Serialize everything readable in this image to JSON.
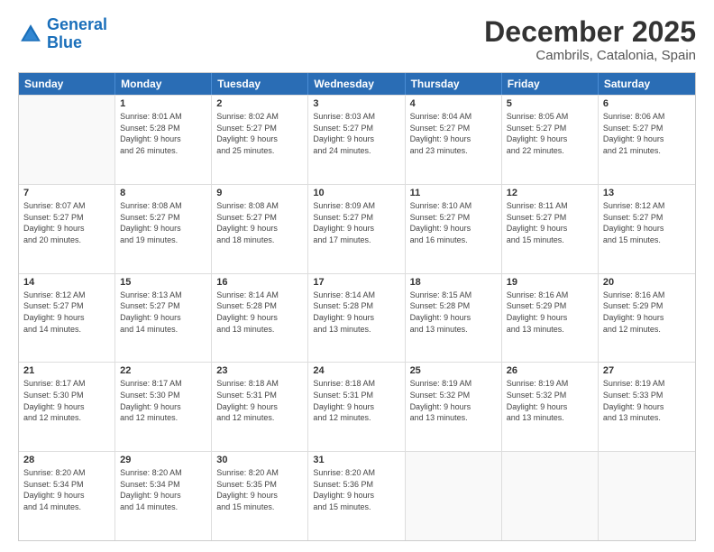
{
  "logo": {
    "line1": "General",
    "line2": "Blue"
  },
  "title": "December 2025",
  "subtitle": "Cambrils, Catalonia, Spain",
  "header_days": [
    "Sunday",
    "Monday",
    "Tuesday",
    "Wednesday",
    "Thursday",
    "Friday",
    "Saturday"
  ],
  "weeks": [
    [
      {
        "day": "",
        "info": ""
      },
      {
        "day": "1",
        "info": "Sunrise: 8:01 AM\nSunset: 5:28 PM\nDaylight: 9 hours\nand 26 minutes."
      },
      {
        "day": "2",
        "info": "Sunrise: 8:02 AM\nSunset: 5:27 PM\nDaylight: 9 hours\nand 25 minutes."
      },
      {
        "day": "3",
        "info": "Sunrise: 8:03 AM\nSunset: 5:27 PM\nDaylight: 9 hours\nand 24 minutes."
      },
      {
        "day": "4",
        "info": "Sunrise: 8:04 AM\nSunset: 5:27 PM\nDaylight: 9 hours\nand 23 minutes."
      },
      {
        "day": "5",
        "info": "Sunrise: 8:05 AM\nSunset: 5:27 PM\nDaylight: 9 hours\nand 22 minutes."
      },
      {
        "day": "6",
        "info": "Sunrise: 8:06 AM\nSunset: 5:27 PM\nDaylight: 9 hours\nand 21 minutes."
      }
    ],
    [
      {
        "day": "7",
        "info": "Sunrise: 8:07 AM\nSunset: 5:27 PM\nDaylight: 9 hours\nand 20 minutes."
      },
      {
        "day": "8",
        "info": "Sunrise: 8:08 AM\nSunset: 5:27 PM\nDaylight: 9 hours\nand 19 minutes."
      },
      {
        "day": "9",
        "info": "Sunrise: 8:08 AM\nSunset: 5:27 PM\nDaylight: 9 hours\nand 18 minutes."
      },
      {
        "day": "10",
        "info": "Sunrise: 8:09 AM\nSunset: 5:27 PM\nDaylight: 9 hours\nand 17 minutes."
      },
      {
        "day": "11",
        "info": "Sunrise: 8:10 AM\nSunset: 5:27 PM\nDaylight: 9 hours\nand 16 minutes."
      },
      {
        "day": "12",
        "info": "Sunrise: 8:11 AM\nSunset: 5:27 PM\nDaylight: 9 hours\nand 15 minutes."
      },
      {
        "day": "13",
        "info": "Sunrise: 8:12 AM\nSunset: 5:27 PM\nDaylight: 9 hours\nand 15 minutes."
      }
    ],
    [
      {
        "day": "14",
        "info": "Sunrise: 8:12 AM\nSunset: 5:27 PM\nDaylight: 9 hours\nand 14 minutes."
      },
      {
        "day": "15",
        "info": "Sunrise: 8:13 AM\nSunset: 5:27 PM\nDaylight: 9 hours\nand 14 minutes."
      },
      {
        "day": "16",
        "info": "Sunrise: 8:14 AM\nSunset: 5:28 PM\nDaylight: 9 hours\nand 13 minutes."
      },
      {
        "day": "17",
        "info": "Sunrise: 8:14 AM\nSunset: 5:28 PM\nDaylight: 9 hours\nand 13 minutes."
      },
      {
        "day": "18",
        "info": "Sunrise: 8:15 AM\nSunset: 5:28 PM\nDaylight: 9 hours\nand 13 minutes."
      },
      {
        "day": "19",
        "info": "Sunrise: 8:16 AM\nSunset: 5:29 PM\nDaylight: 9 hours\nand 13 minutes."
      },
      {
        "day": "20",
        "info": "Sunrise: 8:16 AM\nSunset: 5:29 PM\nDaylight: 9 hours\nand 12 minutes."
      }
    ],
    [
      {
        "day": "21",
        "info": "Sunrise: 8:17 AM\nSunset: 5:30 PM\nDaylight: 9 hours\nand 12 minutes."
      },
      {
        "day": "22",
        "info": "Sunrise: 8:17 AM\nSunset: 5:30 PM\nDaylight: 9 hours\nand 12 minutes."
      },
      {
        "day": "23",
        "info": "Sunrise: 8:18 AM\nSunset: 5:31 PM\nDaylight: 9 hours\nand 12 minutes."
      },
      {
        "day": "24",
        "info": "Sunrise: 8:18 AM\nSunset: 5:31 PM\nDaylight: 9 hours\nand 12 minutes."
      },
      {
        "day": "25",
        "info": "Sunrise: 8:19 AM\nSunset: 5:32 PM\nDaylight: 9 hours\nand 13 minutes."
      },
      {
        "day": "26",
        "info": "Sunrise: 8:19 AM\nSunset: 5:32 PM\nDaylight: 9 hours\nand 13 minutes."
      },
      {
        "day": "27",
        "info": "Sunrise: 8:19 AM\nSunset: 5:33 PM\nDaylight: 9 hours\nand 13 minutes."
      }
    ],
    [
      {
        "day": "28",
        "info": "Sunrise: 8:20 AM\nSunset: 5:34 PM\nDaylight: 9 hours\nand 14 minutes."
      },
      {
        "day": "29",
        "info": "Sunrise: 8:20 AM\nSunset: 5:34 PM\nDaylight: 9 hours\nand 14 minutes."
      },
      {
        "day": "30",
        "info": "Sunrise: 8:20 AM\nSunset: 5:35 PM\nDaylight: 9 hours\nand 15 minutes."
      },
      {
        "day": "31",
        "info": "Sunrise: 8:20 AM\nSunset: 5:36 PM\nDaylight: 9 hours\nand 15 minutes."
      },
      {
        "day": "",
        "info": ""
      },
      {
        "day": "",
        "info": ""
      },
      {
        "day": "",
        "info": ""
      }
    ]
  ]
}
